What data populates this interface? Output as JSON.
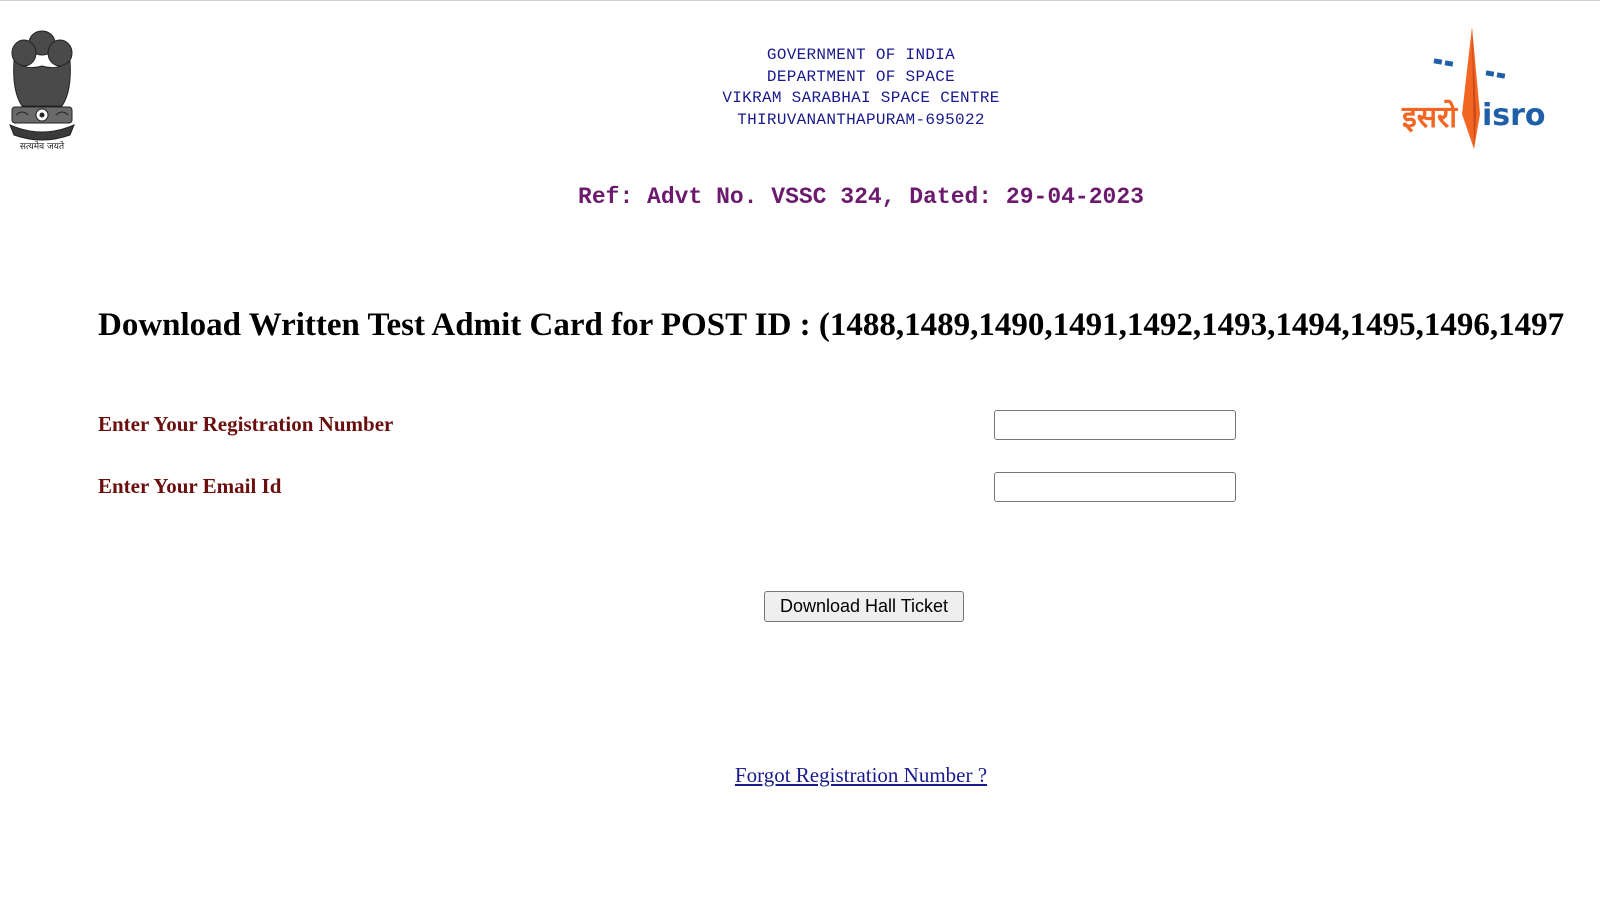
{
  "header": {
    "emblem_icon": "national-emblem-icon",
    "emblem_motto": "सत्यमेव जयते",
    "logo_icon": "isro-logo-icon",
    "logo_text_hindi": "इसरो",
    "logo_text_english": "isro",
    "org_lines": [
      "GOVERNMENT OF INDIA",
      "DEPARTMENT OF SPACE",
      "VIKRAM SARABHAI SPACE CENTRE",
      "THIRUVANANTHAPURAM-695022"
    ],
    "reference": "Ref: Advt No. VSSC 324, Dated: 29-04-2023"
  },
  "main": {
    "title": "Download Written Test Admit Card for POST ID : (1488,1489,1490,1491,1492,1493,1494,1495,1496,1497",
    "form": {
      "registration_label": "Enter Your Registration Number",
      "registration_value": "",
      "email_label": "Enter Your Email Id",
      "email_value": "",
      "submit_label": "Download Hall Ticket"
    },
    "forgot_link": "Forgot Registration Number ?"
  },
  "colors": {
    "org_text": "#1a1a8c",
    "reference_text": "#6b1a6e",
    "label_text": "#6b0e0e",
    "link_text": "#1a1a8c",
    "isro_orange": "#f26522",
    "isro_blue": "#1f5fa8"
  }
}
